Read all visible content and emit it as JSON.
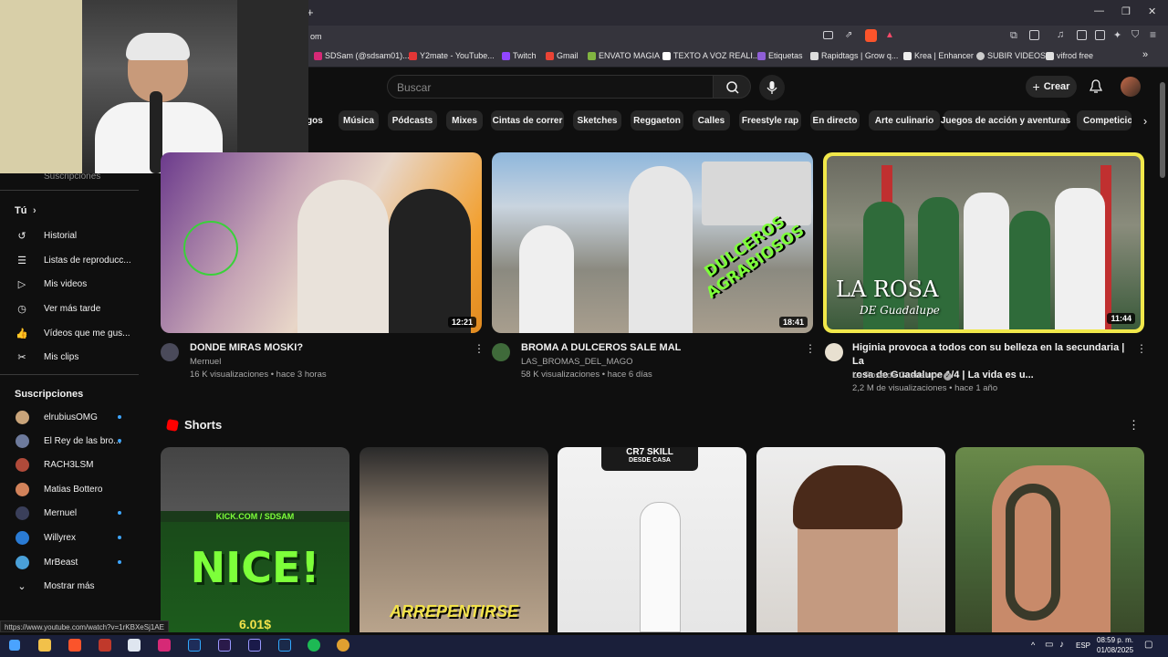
{
  "browser": {
    "address_text": "om",
    "bookmarks": [
      "SDSam (@sdsam01)...",
      "Y2mate - YouTube...",
      "Twitch",
      "Gmail",
      "ENVATO MAGIA",
      "TEXTO A VOZ REALI...",
      "Etiquetas",
      "Rapidtags | Grow q...",
      "Krea | Enhancer",
      "SUBIR VIDEOS",
      "vifrod free"
    ],
    "new_tab": "+",
    "more_bookmarks": "»"
  },
  "header": {
    "search_placeholder": "Buscar",
    "create_label": "Crear"
  },
  "chips": [
    "gos",
    "Música",
    "Pódcasts",
    "Mixes",
    "Cintas de correr",
    "Sketches",
    "Reggaeton",
    "Calles",
    "Freestyle rap",
    "En directo",
    "Arte culinario",
    "Juegos de acción y aventuras",
    "Competicion"
  ],
  "sidebar": {
    "top_partial": "Suscripciones",
    "you_label": "Tú",
    "you_items": [
      {
        "label": "Historial",
        "icon": "history-icon"
      },
      {
        "label": "Listas de reproducc...",
        "icon": "playlist-icon"
      },
      {
        "label": "Mis videos",
        "icon": "my-videos-icon"
      },
      {
        "label": "Ver más tarde",
        "icon": "clock-icon"
      },
      {
        "label": "Vídeos que me gus...",
        "icon": "thumbs-up-icon"
      },
      {
        "label": "Mis clips",
        "icon": "scissors-icon"
      }
    ],
    "subs_label": "Suscripciones",
    "subs": [
      {
        "label": "elrubiusOMG",
        "dot": true,
        "color": "#c9a47a"
      },
      {
        "label": "El Rey de las bro...",
        "dot": true,
        "color": "#6d7a9c"
      },
      {
        "label": "RACH3LSM",
        "dot": false,
        "color": "#b04a3a"
      },
      {
        "label": "Matias Bottero",
        "dot": false,
        "color": "#d2825a"
      },
      {
        "label": "Mernuel",
        "dot": true,
        "color": "#3a3f5a"
      },
      {
        "label": "Willyrex",
        "dot": true,
        "color": "#2a7bd4"
      },
      {
        "label": "MrBeast",
        "dot": true,
        "color": "#4aa0d8"
      }
    ],
    "show_more": "Mostrar más"
  },
  "videos": [
    {
      "title": "DONDE MIRAS MOSKI?",
      "channel": "Mernuel",
      "meta": "16 K visualizaciones • hace 3 horas",
      "duration": "12:21"
    },
    {
      "title": "BROMA A DULCEROS SALE MAL",
      "channel": "LAS_BROMAS_DEL_MAGO",
      "meta": "58 K visualizaciones • hace 6 días",
      "duration": "18:41",
      "overlay": "DULCEROS AGRABIOSOS"
    },
    {
      "title_line1": "Higinia provoca a todos con su belleza en la secundaria | La",
      "title_line2": "rosa de Guadalupe 1/4 | La vida es u...",
      "channel": "La Rosa de Guadalupe",
      "meta": "2,2 M de visualizaciones • hace 1 año",
      "duration": "11:44",
      "overlay_line1": "LA ROSA",
      "overlay_line2": "DE Guadalupe"
    }
  ],
  "shorts": {
    "title": "Shorts",
    "items": [
      {
        "overlay_top": "KICK.COM / SDSAM",
        "overlay_big": "NICE!",
        "overlay_bottom": "6.01$"
      },
      {
        "overlay_bottom": "ARREPENTIRSE"
      },
      {
        "overlay_top": "CR7 SKILL",
        "overlay_sub": "DESDE CASA"
      },
      {},
      {}
    ]
  },
  "status_url": "https://www.youtube.com/watch?v=1rKBXeSj1AE",
  "taskbar": {
    "lang": "ESP",
    "time": "08:59 p. m.",
    "date": "01/08/2025"
  },
  "colors": {
    "background": "#0f0f0f",
    "chip": "#272727",
    "accent_red": "#ff0000",
    "highlight_yellow": "#f1e84a",
    "link_blue": "#3ea6ff"
  }
}
